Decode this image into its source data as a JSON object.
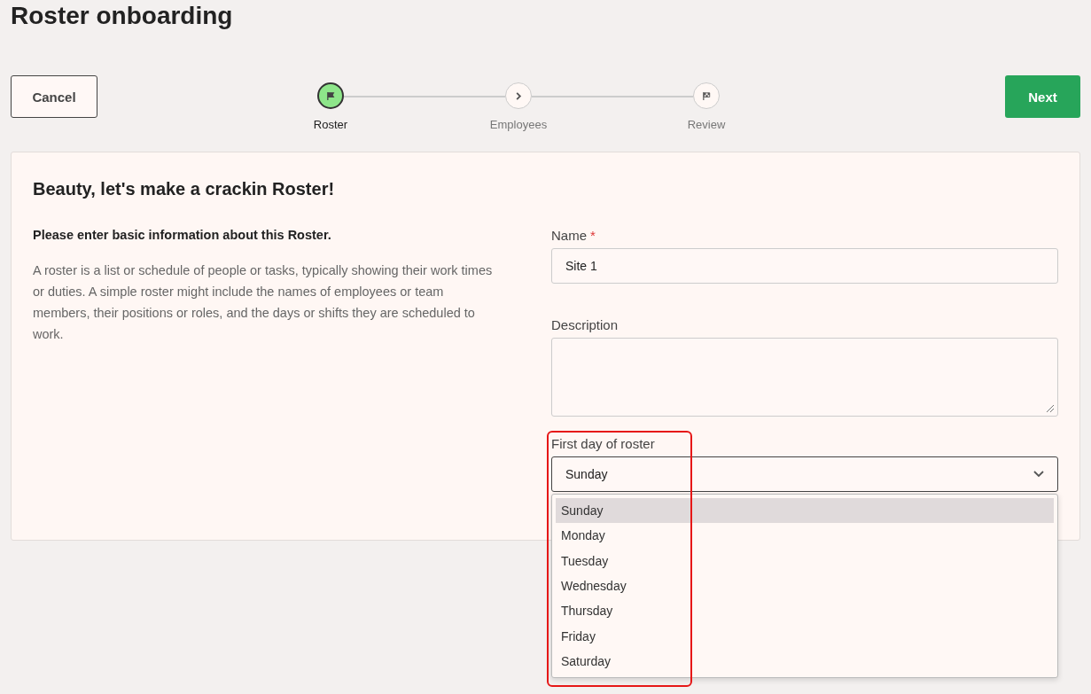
{
  "page": {
    "title": "Roster onboarding"
  },
  "actions": {
    "cancel": "Cancel",
    "next": "Next"
  },
  "steps": [
    {
      "label": "Roster",
      "kind": "flag",
      "selected": true
    },
    {
      "label": "Employees",
      "kind": "chevron",
      "selected": false
    },
    {
      "label": "Review",
      "kind": "finish",
      "selected": false
    }
  ],
  "card": {
    "heading": "Beauty, let's make a crackin Roster!",
    "intro_title": "Please enter basic information about this Roster.",
    "intro_text": "A roster is a list or schedule of people or tasks, typically showing their work times or duties. A simple roster might include the names of employees or team members, their positions or roles, and the days or shifts they are scheduled to work."
  },
  "fields": {
    "name": {
      "label": "Name",
      "required_mark": "*",
      "value": "Site 1"
    },
    "description": {
      "label": "Description"
    },
    "first_day": {
      "label": "First day of roster",
      "value": "Sunday",
      "expanded": true,
      "highlighted": true,
      "options": [
        {
          "label": "Sunday",
          "selected": true
        },
        {
          "label": "Monday",
          "selected": false
        },
        {
          "label": "Tuesday",
          "selected": false
        },
        {
          "label": "Wednesday",
          "selected": false
        },
        {
          "label": "Thursday",
          "selected": false
        },
        {
          "label": "Friday",
          "selected": false
        },
        {
          "label": "Saturday",
          "selected": false
        }
      ]
    }
  }
}
